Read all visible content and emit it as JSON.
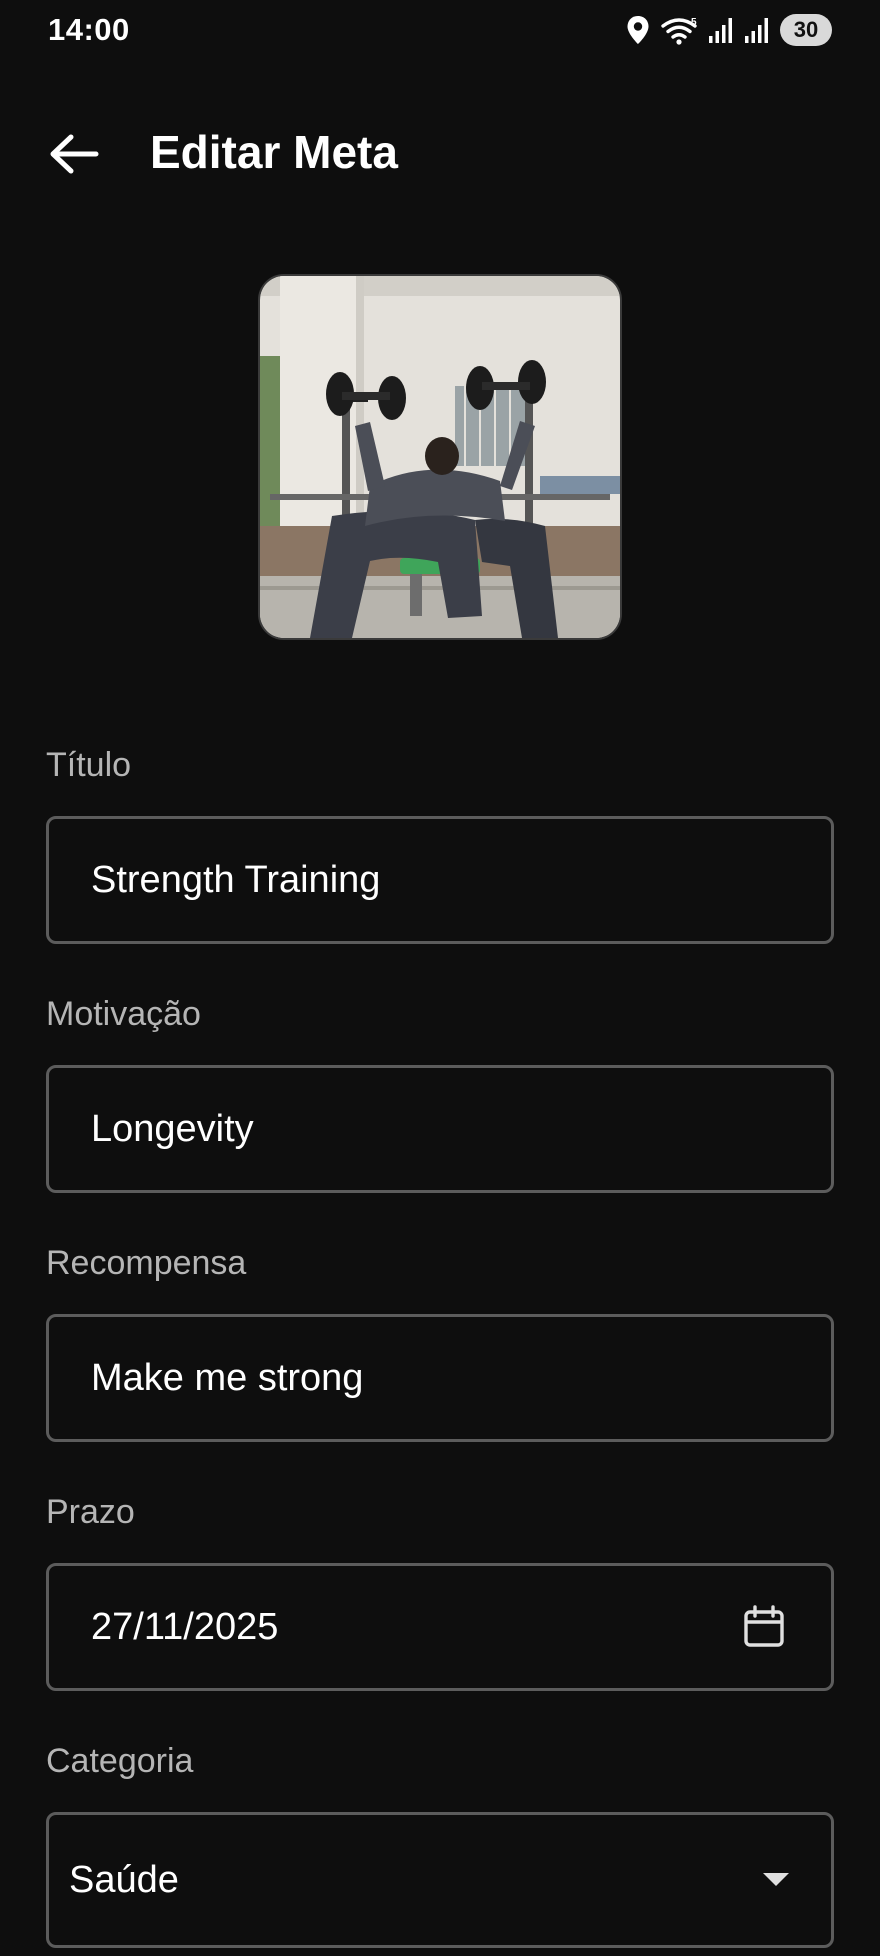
{
  "status_bar": {
    "time": "14:00",
    "battery": "30",
    "icons": [
      "location-icon",
      "wifi-icon",
      "signal-icon",
      "signal-icon"
    ]
  },
  "app_bar": {
    "title": "Editar Meta",
    "back_icon": "arrow-back-icon"
  },
  "image": {
    "subject": "person-lifting-dumbbells"
  },
  "form": {
    "title": {
      "label": "Título",
      "value": "Strength Training"
    },
    "motivation": {
      "label": "Motivação",
      "value": "Longevity"
    },
    "reward": {
      "label": "Recompensa",
      "value": "Make me strong"
    },
    "deadline": {
      "label": "Prazo",
      "value": "27/11/2025",
      "icon": "calendar-icon"
    },
    "category": {
      "label": "Categoria",
      "value": "Saúde",
      "icon": "dropdown-arrow-icon"
    }
  },
  "colors": {
    "background": "#0e0e0e",
    "label": "#b5b5b5",
    "border": "#5c5c5c",
    "text": "#ffffff"
  }
}
